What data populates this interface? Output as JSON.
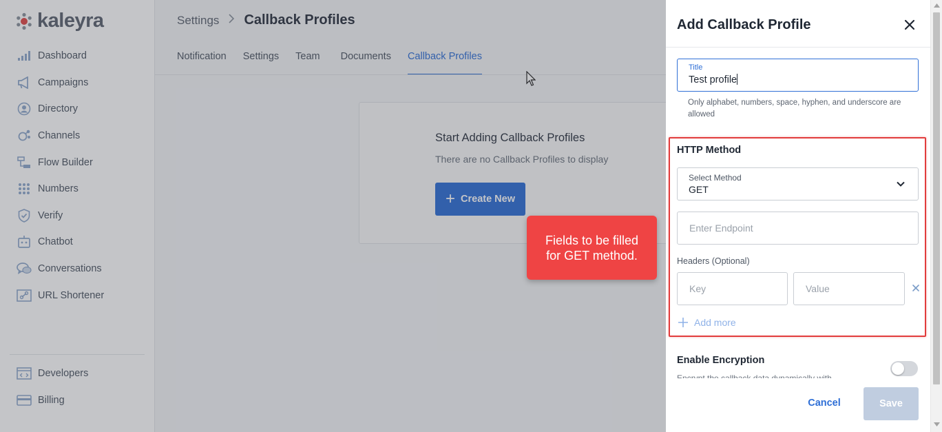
{
  "app": {
    "logo_text": "kaleyra"
  },
  "sidebar": {
    "items": [
      {
        "label": "Dashboard",
        "icon": "bar-chart-icon"
      },
      {
        "label": "Campaigns",
        "icon": "megaphone-icon"
      },
      {
        "label": "Directory",
        "icon": "user-circle-icon"
      },
      {
        "label": "Channels",
        "icon": "channels-icon"
      },
      {
        "label": "Flow Builder",
        "icon": "flow-icon"
      },
      {
        "label": "Numbers",
        "icon": "keypad-icon"
      },
      {
        "label": "Verify",
        "icon": "shield-check-icon"
      },
      {
        "label": "Chatbot",
        "icon": "chatbot-icon"
      },
      {
        "label": "Conversations",
        "icon": "chat-bubbles-icon"
      },
      {
        "label": "URL Shortener",
        "icon": "link-icon"
      }
    ],
    "bottom_items": [
      {
        "label": "Developers",
        "icon": "code-icon"
      },
      {
        "label": "Billing",
        "icon": "card-icon"
      }
    ]
  },
  "header": {
    "breadcrumb_parent": "Settings",
    "breadcrumb_current": "Callback Profiles",
    "tabs": [
      {
        "label": "Notification"
      },
      {
        "label": "Settings"
      },
      {
        "label": "Team"
      },
      {
        "label": "Documents"
      },
      {
        "label": "Callback Profiles",
        "active": true
      }
    ]
  },
  "empty_state": {
    "title": "Start Adding Callback Profiles",
    "subtitle": "There are no Callback Profiles to display",
    "create_label": "Create New"
  },
  "callout": {
    "line1": "Fields to be filled",
    "line2": "for GET method."
  },
  "drawer": {
    "title": "Add Callback Profile",
    "title_field": {
      "label": "Title",
      "value": "Test profile",
      "hint": "Only alphabet, numbers, space, hyphen, and underscore are allowed"
    },
    "http_method": {
      "section_label": "HTTP Method",
      "select_label": "Select Method",
      "selected": "GET",
      "endpoint_placeholder": "Enter Endpoint",
      "headers_label": "Headers (Optional)",
      "key_placeholder": "Key",
      "value_placeholder": "Value",
      "add_more_label": "Add more"
    },
    "encryption": {
      "title": "Enable Encryption",
      "description": "Encrypt the callback data dynamically with",
      "enabled": false
    },
    "cancel_label": "Cancel",
    "save_label": "Save"
  },
  "colors": {
    "primary": "#2f6fd6",
    "callout": "#ef4444",
    "highlight": "#e23c3c",
    "save_disabled": "#c0cde0"
  }
}
